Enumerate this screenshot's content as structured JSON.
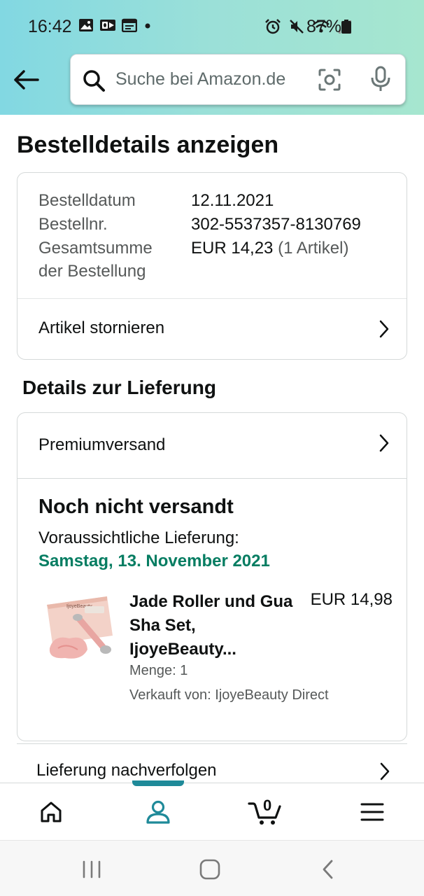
{
  "status_bar": {
    "time": "16:42",
    "battery": "87%",
    "icons_left": [
      "image-icon",
      "outlook-icon",
      "calendar-icon",
      "dot-icon"
    ],
    "icons_right": [
      "alarm-icon",
      "mute-icon",
      "wifi-icon",
      "signal-icon",
      "battery-icon"
    ]
  },
  "search": {
    "placeholder": "Suche bei Amazon.de"
  },
  "page": {
    "title": "Bestelldetails anzeigen"
  },
  "order": {
    "date_label": "Bestelldatum",
    "date_value": "12.11.2021",
    "number_label": "Bestellnr.",
    "number_value": "302-5537357-8130769",
    "total_label_line1": "Gesamtsumme",
    "total_label_line2": "der Bestellung",
    "total_value": "EUR 14,23",
    "total_items": "(1 Artikel)",
    "cancel_label": "Artikel stornieren"
  },
  "delivery": {
    "section_title": "Details zur Lieferung",
    "shipping_method": "Premiumversand",
    "status": "Noch nicht versandt",
    "estimate_label": "Voraussichtliche Lieferung:",
    "estimate_date": "Samstag, 13. November 2021",
    "product": {
      "title_line1": "Jade Roller und Gua",
      "title_line2": "Sha Set,",
      "title_line3": "IjoyeBeauty...",
      "price": "EUR 14,98",
      "quantity": "Menge: 1",
      "seller": "Verkauft von: IjoyeBeauty Direct",
      "image_brand": "IjoyeBeauty"
    },
    "track_label": "Lieferung nachverfolgen"
  },
  "bottom_nav": {
    "active": "account",
    "cart_count": "0"
  },
  "colors": {
    "accent": "#1f8a99",
    "delivery_green": "#067d62",
    "header_gradient_start": "#82d8e2",
    "header_gradient_end": "#a6e6cf"
  }
}
